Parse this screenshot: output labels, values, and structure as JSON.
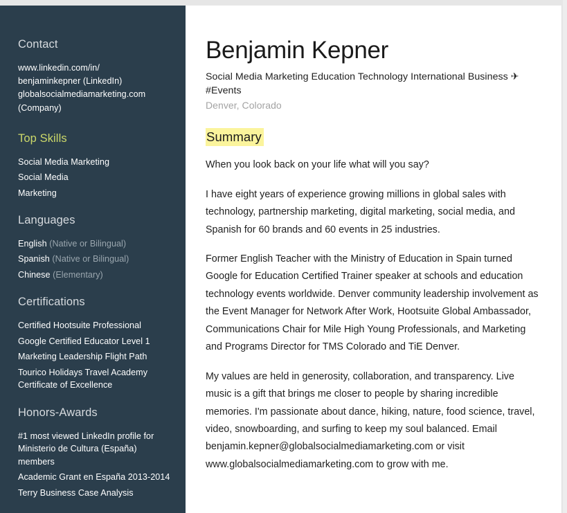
{
  "document": {
    "type": "resume-pdf-page",
    "accent_color": "#ccd86a",
    "sidebar_color": "#2b3e4c",
    "highlight_color": "#fbf49c"
  },
  "sidebar": {
    "contact": {
      "heading": "Contact",
      "lines": [
        {
          "text": "www.linkedin.com/in/",
          "label": ""
        },
        {
          "text": "benjaminkepner",
          "label": " (LinkedIn)"
        },
        {
          "text": "globalsocialmediamarketing.com",
          "label": ""
        },
        {
          "text": "",
          "label": "(Company)"
        }
      ]
    },
    "top_skills": {
      "heading": "Top Skills",
      "items": [
        {
          "text": "Social Media Marketing",
          "label": ""
        },
        {
          "text": "Social Media",
          "label": ""
        },
        {
          "text": "Marketing",
          "label": ""
        }
      ]
    },
    "languages": {
      "heading": "Languages",
      "items": [
        {
          "text": "English",
          "label": " (Native or Bilingual)"
        },
        {
          "text": "Spanish",
          "label": " (Native or Bilingual)"
        },
        {
          "text": "Chinese",
          "label": " (Elementary)"
        }
      ]
    },
    "certifications": {
      "heading": "Certifications",
      "items": [
        {
          "text": "Certified Hootsuite Professional",
          "label": ""
        },
        {
          "text": "Google Certified Educator Level 1",
          "label": ""
        },
        {
          "text": "Marketing Leadership Flight Path",
          "label": ""
        },
        {
          "text": "Tourico Holidays Travel Academy Certificate of Excellence",
          "label": ""
        }
      ]
    },
    "honors_awards": {
      "heading": "Honors-Awards",
      "items": [
        {
          "text": "#1 most viewed LinkedIn profile for Ministerio de Cultura (España) members",
          "label": ""
        },
        {
          "text": "Academic Grant en España 2013-2014",
          "label": ""
        },
        {
          "text": "Terry Business Case Analysis",
          "label": ""
        }
      ]
    }
  },
  "main": {
    "name": "Benjamin Kepner",
    "headline": "Social Media Marketing Education Technology  International Business ✈#Events",
    "location": "Denver, Colorado",
    "summary_heading": "Summary",
    "paragraphs": [
      "When you look back on your life what will you say?",
      "I have eight years of experience growing millions in global sales with technology, partnership marketing, digital marketing, social media, and Spanish for 60 brands and 60 events in 25 industries.",
      "Former English Teacher with the Ministry of Education in Spain turned Google for Education Certified Trainer speaker at schools and education technology events worldwide. Denver community leadership involvement as the Event Manager for Network After Work, Hootsuite Global Ambassador, Communications Chair for Mile High Young Professionals, and Marketing and Programs Director for TMS Colorado and TiE Denver.",
      "My values are held in generosity, collaboration, and transparency. Live music is a gift that brings me closer to people by sharing incredible memories. I'm passionate about dance, hiking, nature, food science, travel, video, snowboarding, and surfing to keep my soul balanced. Email benjamin.kepner@globalsocialmediamarketing.com or visit www.globalsocialmediamarketing.com to grow with me."
    ]
  }
}
